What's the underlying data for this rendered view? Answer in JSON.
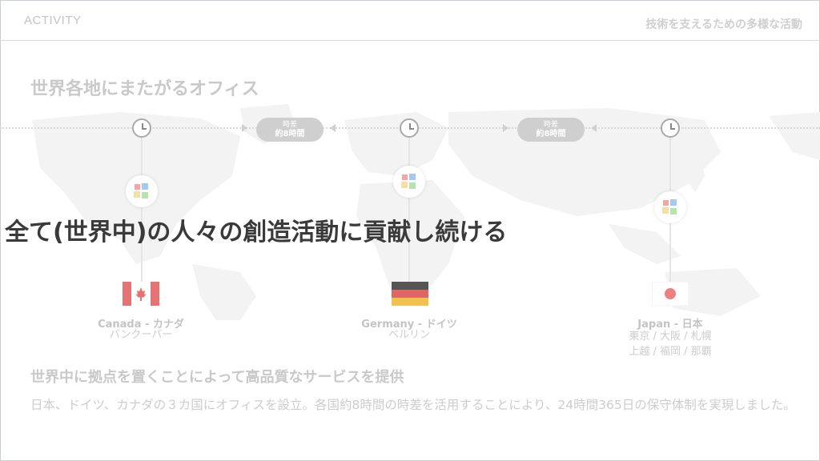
{
  "header": {
    "section_label": "ACTIVITY",
    "title": "技術を支えるための多様な活動"
  },
  "slide": {
    "title": "世界各地にまたがるオフィス",
    "overlay_text": "全て(世界中)の人々の創造活動に貢献し続ける"
  },
  "timezone_diffs": [
    {
      "label": "時差",
      "value": "約8時間"
    },
    {
      "label": "時差",
      "value": "約8時間"
    }
  ],
  "locations": [
    {
      "name": "Canada - カナダ",
      "cities": [
        "バンクーバー"
      ]
    },
    {
      "name": "Germany - ドイツ",
      "cities": [
        "ベルリン"
      ]
    },
    {
      "name": "Japan - 日本",
      "cities": [
        "東京 / 大阪 / 札幌",
        "上越 / 福岡 / 那覇"
      ]
    }
  ],
  "footer": {
    "heading": "世界中に拠点を置くことによって高品質なサービスを提供",
    "body": "日本、ドイツ、カナダの３カ国にオフィスを設立。各国約8時間の時差を活用することにより、24時間365日の保守体制を実現しました。"
  },
  "colors": {
    "canada_red": "#e57373",
    "germany_black": "#555555",
    "germany_red": "#e06666",
    "germany_gold": "#f2c14e",
    "japan_red": "#f08080"
  }
}
